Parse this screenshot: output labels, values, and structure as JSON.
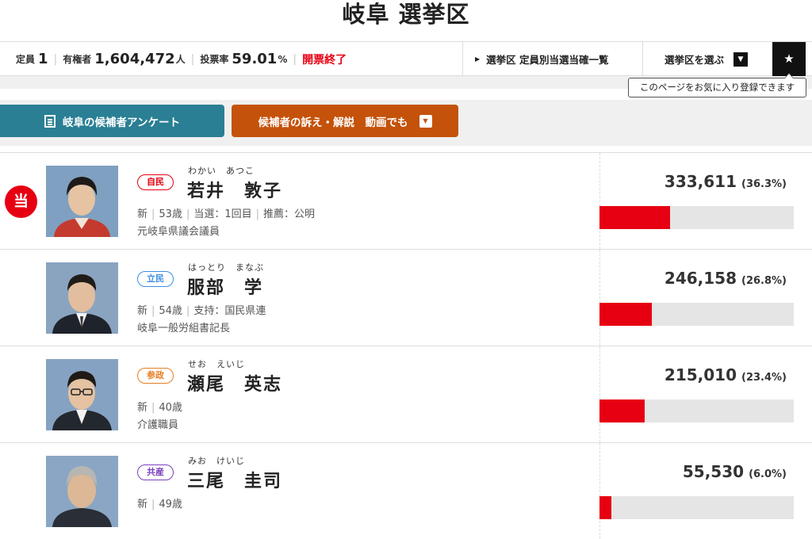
{
  "header": {
    "title": "岐阜 選挙区"
  },
  "stats": {
    "seats_label": "定員",
    "seats": "1",
    "voters_label": "有権者",
    "voters": "1,604,472",
    "voters_unit": "人",
    "turnout_label": "投票率",
    "turnout": "59.01",
    "turnout_unit": "%",
    "status": "開票終了"
  },
  "nav": {
    "winners_link": "選挙区 定員別当選当確一覧",
    "select_district": "選挙区を選ぶ",
    "favorite_tooltip": "このページをお気に入り登録できます"
  },
  "buttons": {
    "survey": "岐阜の候補者アンケート",
    "video": "候補者の訴え・解説　動画でも"
  },
  "elected_mark": "当",
  "colors": {
    "accent_red": "#e60012",
    "survey_btn": "#2a7f94",
    "video_btn": "#c4520a",
    "party_ldp": "#e60012",
    "party_cdp": "#3a8ee6",
    "party_sanseito": "#e67e22",
    "party_jcp": "#7b3fbf"
  },
  "candidates": [
    {
      "party": "自民",
      "kana": "わかい　あつこ",
      "name": "若井　敦子",
      "status": "新",
      "age": "53歳",
      "extra1": "当選：1回目",
      "extra2": "推薦：公明",
      "career": "元岐阜県議会議員",
      "votes": "333,611",
      "pct": "(36.3%)",
      "share": 36.3,
      "elected": true
    },
    {
      "party": "立民",
      "kana": "はっとり　まなぶ",
      "name": "服部　学",
      "status": "新",
      "age": "54歳",
      "extra1": "支持：国民県連",
      "extra2": "",
      "career": "岐阜一般労組書記長",
      "votes": "246,158",
      "pct": "(26.8%)",
      "share": 26.8,
      "elected": false
    },
    {
      "party": "参政",
      "kana": "せお　えいじ",
      "name": "瀬尾　英志",
      "status": "新",
      "age": "40歳",
      "extra1": "",
      "extra2": "",
      "career": "介護職員",
      "votes": "215,010",
      "pct": "(23.4%)",
      "share": 23.4,
      "elected": false
    },
    {
      "party": "共産",
      "kana": "みお　けいじ",
      "name": "三尾　圭司",
      "status": "新",
      "age": "49歳",
      "extra1": "",
      "extra2": "",
      "career": "",
      "votes": "55,530",
      "pct": "(6.0%)",
      "share": 6.0,
      "elected": false
    }
  ]
}
